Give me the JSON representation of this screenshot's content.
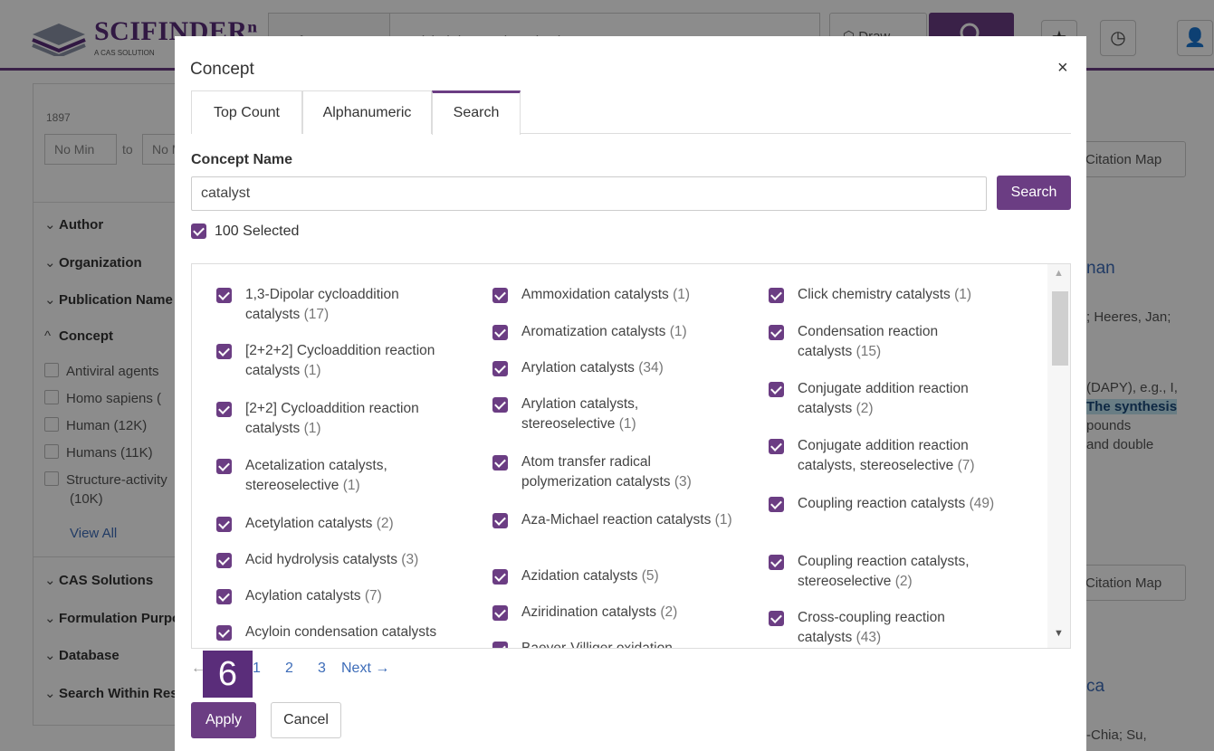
{
  "app": {
    "logo_text": "SCIFINDERⁿ",
    "logo_sub": "A CAS SOLUTION",
    "ref_type": "References",
    "query": "antiviral drug and synthesis",
    "draw_label": "Draw"
  },
  "left_panel": {
    "year": "1897",
    "min_placeholder": "No Min",
    "to_label": "to",
    "max_placeholder": "No Max",
    "facets": [
      "Author",
      "Organization",
      "Publication Name",
      "Concept",
      "CAS Solutions",
      "Formulation Purpose",
      "Database",
      "Search Within Results"
    ],
    "concept_options": [
      "Antiviral agents",
      "Homo sapiens (",
      "Human (12K)",
      "Humans (11K)",
      "Structure-activity",
      "(10K)"
    ],
    "view_all": "View All"
  },
  "right_panel": {
    "citation_map": "Citation Map",
    "title_fragment_1": "nan",
    "authors_fragment_1": "; Heeres, Jan;",
    "snippet": [
      "(DAPY), e.g., I,",
      "The synthesis",
      "pounds",
      "and double"
    ],
    "title_fragment_2": "ca",
    "authors_fragment_2": "-Chia; Su,"
  },
  "modal": {
    "title": "Concept",
    "close": "×",
    "tabs": [
      "Top Count",
      "Alphanumeric",
      "Search"
    ],
    "active_tab": "Search",
    "concept_name_label": "Concept Name",
    "concept_value": "catalyst",
    "search_button": "Search",
    "selected_label": "100 Selected",
    "columns": [
      [
        {
          "name": "1,3-Dipolar cycloaddition catalysts",
          "count": "(17)"
        },
        {
          "name": "[2+2+2] Cycloaddition reaction catalysts",
          "count": "(1)"
        },
        {
          "name": "[2+2] Cycloaddition reaction catalysts",
          "count": "(1)"
        },
        {
          "name": "Acetalization catalysts, stereoselective",
          "count": "(1)"
        },
        {
          "name": "Acetylation catalysts",
          "count": "(2)"
        },
        {
          "name": "Acid hydrolysis catalysts",
          "count": "(3)"
        },
        {
          "name": "Acylation catalysts",
          "count": "(7)"
        },
        {
          "name": "Acyloin condensation catalysts",
          "count": ""
        }
      ],
      [
        {
          "name": "Ammoxidation catalysts",
          "count": "(1)"
        },
        {
          "name": "Aromatization catalysts",
          "count": "(1)"
        },
        {
          "name": "Arylation catalysts",
          "count": "(34)"
        },
        {
          "name": "Arylation catalysts, stereoselective",
          "count": "(1)"
        },
        {
          "name": "Atom transfer radical polymerization catalysts",
          "count": "(3)"
        },
        {
          "name": "Aza-Michael reaction catalysts",
          "count": "(1)"
        },
        {
          "name": "Azidation catalysts",
          "count": "(5)"
        },
        {
          "name": "Aziridination catalysts",
          "count": "(2)"
        },
        {
          "name": "Baeyer-Villiger oxidation",
          "count": ""
        }
      ],
      [
        {
          "name": "Click chemistry catalysts",
          "count": "(1)"
        },
        {
          "name": "Condensation reaction catalysts",
          "count": "(15)"
        },
        {
          "name": "Conjugate addition reaction catalysts",
          "count": "(2)"
        },
        {
          "name": "Conjugate addition reaction catalysts, stereoselective",
          "count": "(7)"
        },
        {
          "name": "Coupling reaction catalysts",
          "count": "(49)"
        },
        {
          "name": "Coupling reaction catalysts, stereoselective",
          "count": "(2)"
        },
        {
          "name": "Cross-coupling reaction catalysts",
          "count": "(43)"
        }
      ]
    ],
    "pager": {
      "prev": "←",
      "pages": [
        "1",
        "2",
        "3"
      ],
      "next": "Next →"
    },
    "step_badge": "6",
    "apply": "Apply",
    "cancel": "Cancel"
  },
  "colors": {
    "brand": "#6b3d83",
    "link": "#3d6cb8"
  }
}
